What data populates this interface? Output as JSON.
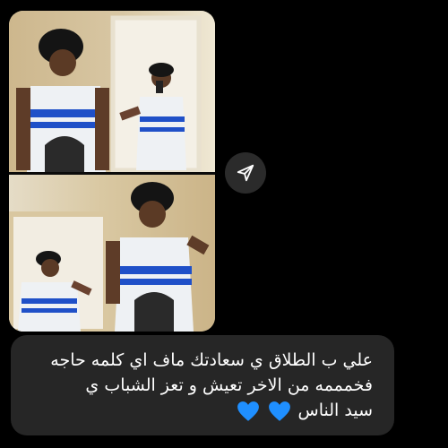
{
  "media": {
    "photos": [
      {
        "name": "mirror-selfie-top"
      },
      {
        "name": "mirror-selfie-bottom"
      }
    ]
  },
  "share": {
    "icon": "send-icon",
    "color": "#ffffff"
  },
  "message": {
    "lines": [
      "علي ب الطلاق ي سعادتك ماف اي كلمه حاجه",
      "فخمممه من الاخر تعيش و تعز الشباب ي",
      "سيد الناس"
    ],
    "emojis": [
      "blue-heart-icon",
      "blue-heart-icon"
    ],
    "heart_color": "#1f8fff",
    "bubble_color": "#262626",
    "text_color": "#ffffff"
  }
}
